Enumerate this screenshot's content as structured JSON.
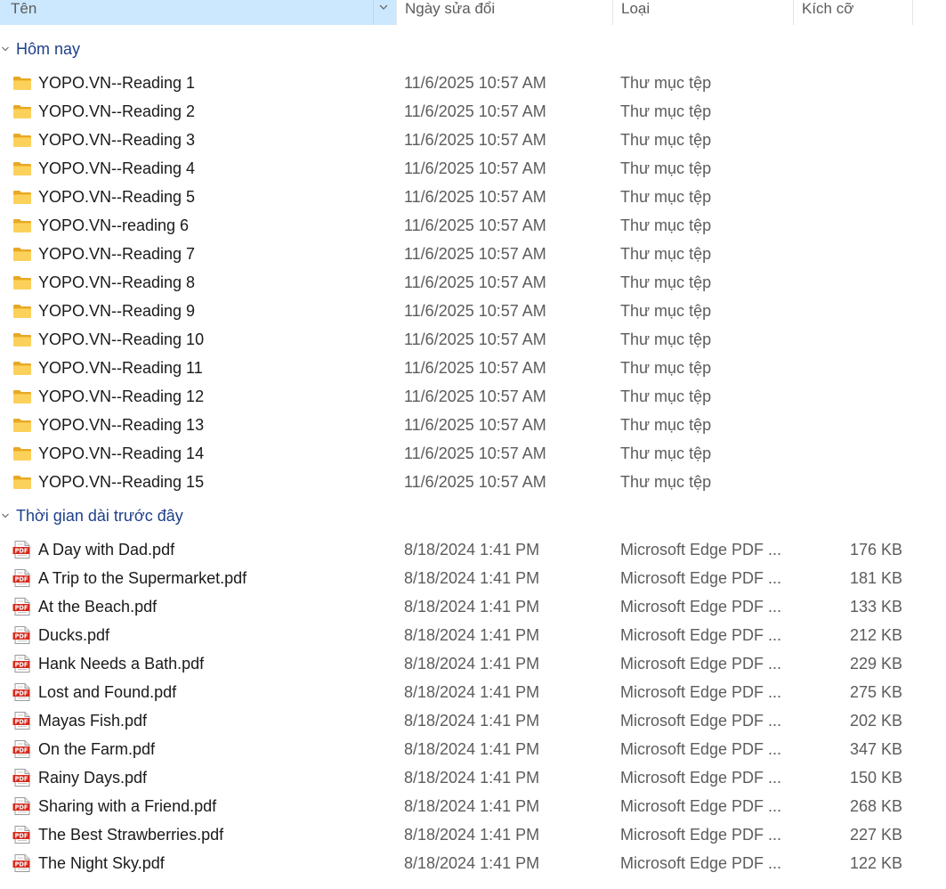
{
  "header": {
    "name": "Tên",
    "date": "Ngày sửa đổi",
    "type": "Loại",
    "size": "Kích cỡ"
  },
  "colors": {
    "header_selected_bg": "#cce8ff",
    "group_label": "#1e3f8a",
    "folder_yellow": "#f8c94a",
    "pdf_red": "#d42b1e"
  },
  "groups": [
    {
      "label": "Hôm nay",
      "items": [
        {
          "name": "YOPO.VN--Reading 1",
          "date": "11/6/2025 10:57 AM",
          "type": "Thư mục tệp",
          "size": "",
          "icon": "folder-icon"
        },
        {
          "name": "YOPO.VN--Reading 2",
          "date": "11/6/2025 10:57 AM",
          "type": "Thư mục tệp",
          "size": "",
          "icon": "folder-icon"
        },
        {
          "name": "YOPO.VN--Reading 3",
          "date": "11/6/2025 10:57 AM",
          "type": "Thư mục tệp",
          "size": "",
          "icon": "folder-icon"
        },
        {
          "name": "YOPO.VN--Reading 4",
          "date": "11/6/2025 10:57 AM",
          "type": "Thư mục tệp",
          "size": "",
          "icon": "folder-icon"
        },
        {
          "name": "YOPO.VN--Reading 5",
          "date": "11/6/2025 10:57 AM",
          "type": "Thư mục tệp",
          "size": "",
          "icon": "folder-icon"
        },
        {
          "name": "YOPO.VN--reading 6",
          "date": "11/6/2025 10:57 AM",
          "type": "Thư mục tệp",
          "size": "",
          "icon": "folder-icon"
        },
        {
          "name": "YOPO.VN--Reading 7",
          "date": "11/6/2025 10:57 AM",
          "type": "Thư mục tệp",
          "size": "",
          "icon": "folder-icon"
        },
        {
          "name": "YOPO.VN--Reading 8",
          "date": "11/6/2025 10:57 AM",
          "type": "Thư mục tệp",
          "size": "",
          "icon": "folder-icon"
        },
        {
          "name": "YOPO.VN--Reading 9",
          "date": "11/6/2025 10:57 AM",
          "type": "Thư mục tệp",
          "size": "",
          "icon": "folder-icon"
        },
        {
          "name": "YOPO.VN--Reading 10",
          "date": "11/6/2025 10:57 AM",
          "type": "Thư mục tệp",
          "size": "",
          "icon": "folder-icon"
        },
        {
          "name": "YOPO.VN--Reading 11",
          "date": "11/6/2025 10:57 AM",
          "type": "Thư mục tệp",
          "size": "",
          "icon": "folder-icon"
        },
        {
          "name": "YOPO.VN--Reading 12",
          "date": "11/6/2025 10:57 AM",
          "type": "Thư mục tệp",
          "size": "",
          "icon": "folder-icon"
        },
        {
          "name": "YOPO.VN--Reading 13",
          "date": "11/6/2025 10:57 AM",
          "type": "Thư mục tệp",
          "size": "",
          "icon": "folder-icon"
        },
        {
          "name": "YOPO.VN--Reading 14",
          "date": "11/6/2025 10:57 AM",
          "type": "Thư mục tệp",
          "size": "",
          "icon": "folder-icon"
        },
        {
          "name": "YOPO.VN--Reading 15",
          "date": "11/6/2025 10:57 AM",
          "type": "Thư mục tệp",
          "size": "",
          "icon": "folder-icon"
        }
      ]
    },
    {
      "label": "Thời gian dài trước đây",
      "items": [
        {
          "name": "A Day with Dad.pdf",
          "date": "8/18/2024 1:41 PM",
          "type": "Microsoft Edge PDF ...",
          "size": "176 KB",
          "icon": "pdf-icon"
        },
        {
          "name": "A Trip to the Supermarket.pdf",
          "date": "8/18/2024 1:41 PM",
          "type": "Microsoft Edge PDF ...",
          "size": "181 KB",
          "icon": "pdf-icon"
        },
        {
          "name": "At the Beach.pdf",
          "date": "8/18/2024 1:41 PM",
          "type": "Microsoft Edge PDF ...",
          "size": "133 KB",
          "icon": "pdf-icon"
        },
        {
          "name": "Ducks.pdf",
          "date": "8/18/2024 1:41 PM",
          "type": "Microsoft Edge PDF ...",
          "size": "212 KB",
          "icon": "pdf-icon"
        },
        {
          "name": "Hank Needs a Bath.pdf",
          "date": "8/18/2024 1:41 PM",
          "type": "Microsoft Edge PDF ...",
          "size": "229 KB",
          "icon": "pdf-icon"
        },
        {
          "name": "Lost and Found.pdf",
          "date": "8/18/2024 1:41 PM",
          "type": "Microsoft Edge PDF ...",
          "size": "275 KB",
          "icon": "pdf-icon"
        },
        {
          "name": "Mayas Fish.pdf",
          "date": "8/18/2024 1:41 PM",
          "type": "Microsoft Edge PDF ...",
          "size": "202 KB",
          "icon": "pdf-icon"
        },
        {
          "name": "On the Farm.pdf",
          "date": "8/18/2024 1:41 PM",
          "type": "Microsoft Edge PDF ...",
          "size": "347 KB",
          "icon": "pdf-icon"
        },
        {
          "name": "Rainy Days.pdf",
          "date": "8/18/2024 1:41 PM",
          "type": "Microsoft Edge PDF ...",
          "size": "150 KB",
          "icon": "pdf-icon"
        },
        {
          "name": "Sharing with a Friend.pdf",
          "date": "8/18/2024 1:41 PM",
          "type": "Microsoft Edge PDF ...",
          "size": "268 KB",
          "icon": "pdf-icon"
        },
        {
          "name": "The Best Strawberries.pdf",
          "date": "8/18/2024 1:41 PM",
          "type": "Microsoft Edge PDF ...",
          "size": "227 KB",
          "icon": "pdf-icon"
        },
        {
          "name": "The Night Sky.pdf",
          "date": "8/18/2024 1:41 PM",
          "type": "Microsoft Edge PDF ...",
          "size": "122 KB",
          "icon": "pdf-icon"
        }
      ]
    }
  ]
}
